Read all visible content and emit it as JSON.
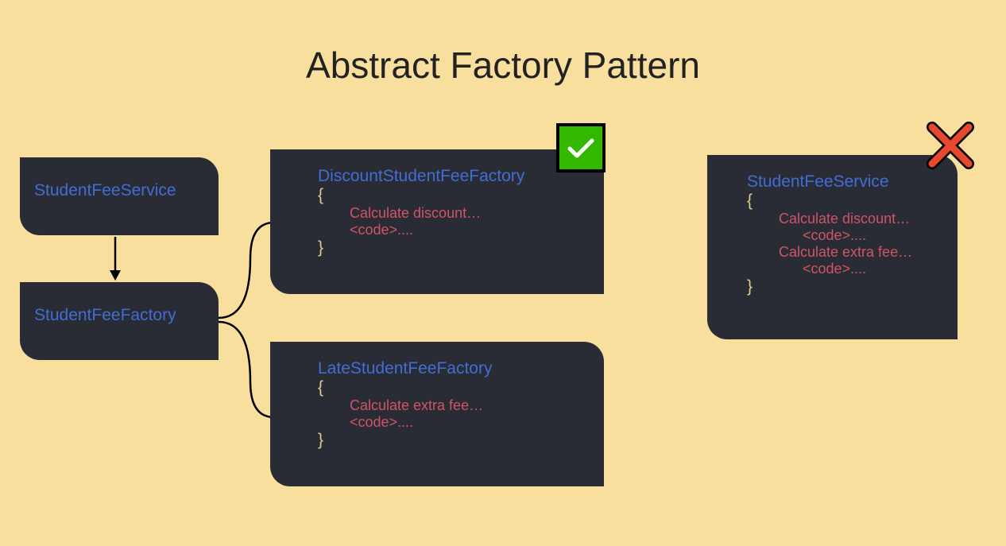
{
  "title": "Abstract Factory Pattern",
  "correct": {
    "serviceBox": {
      "className": "StudentFeeService"
    },
    "factoryBox": {
      "className": "StudentFeeFactory"
    },
    "discountBox": {
      "className": "DiscountStudentFeeFactory",
      "braceOpen": "{",
      "line1": "Calculate discount…",
      "line2": "<code>....",
      "braceClose": "}"
    },
    "lateBox": {
      "className": "LateStudentFeeFactory",
      "braceOpen": "{",
      "line1": "Calculate extra fee…",
      "line2": "<code>....",
      "braceClose": "}"
    }
  },
  "wrong": {
    "serviceBox": {
      "className": "StudentFeeService",
      "braceOpen": "{",
      "line1": "Calculate discount…",
      "line2": "<code>....",
      "line3": "Calculate extra fee…",
      "line4": "<code>....",
      "braceClose": "}"
    }
  }
}
